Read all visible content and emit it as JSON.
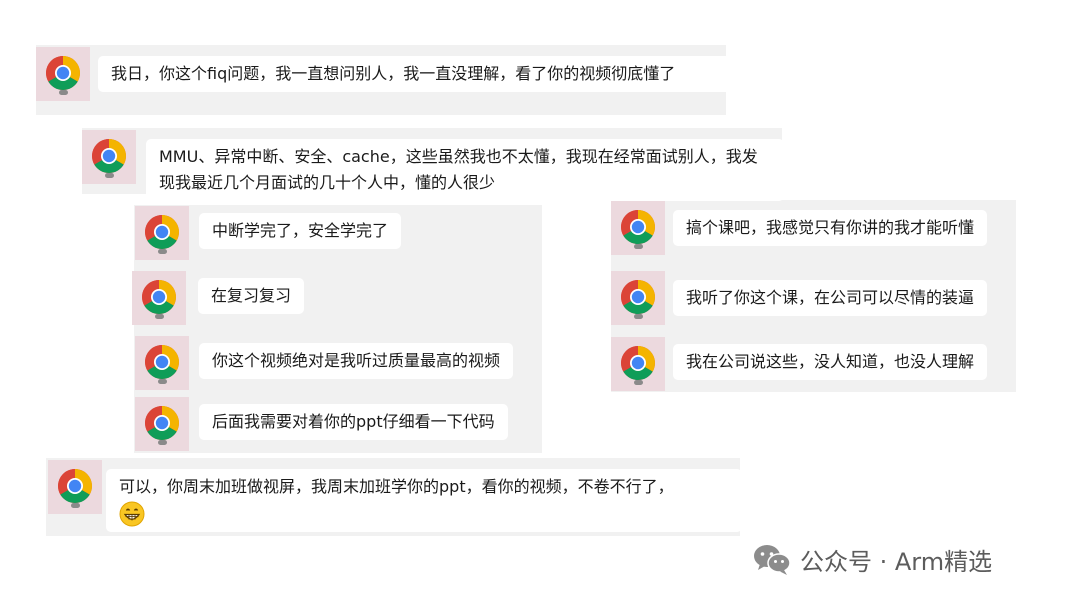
{
  "messages": [
    {
      "text": "我日，你这个fiq问题，我一直想问别人，我一直没理解，看了你的视频彻底懂了",
      "avatar_icon": "chrome-icon"
    },
    {
      "text": "MMU、异常中断、安全、cache，这些虽然我也不太懂，我现在经常面试别人，我发现我最近几个月面试的几十个人中，懂的人很少",
      "avatar_icon": "chrome-icon"
    },
    {
      "text": "中断学完了，安全学完了",
      "avatar_icon": "chrome-icon"
    },
    {
      "text": "在复习复习",
      "avatar_icon": "chrome-icon"
    },
    {
      "text": "你这个视频绝对是我听过质量最高的视频",
      "avatar_icon": "chrome-icon"
    },
    {
      "text": "后面我需要对着你的ppt仔细看一下代码",
      "avatar_icon": "chrome-icon"
    },
    {
      "text": "搞个课吧，我感觉只有你讲的我才能听懂",
      "avatar_icon": "chrome-icon"
    },
    {
      "text": "我听了你这个课，在公司可以尽情的装逼",
      "avatar_icon": "chrome-icon"
    },
    {
      "text": "我在公司说这些，没人知道，也没人理解",
      "avatar_icon": "chrome-icon"
    },
    {
      "text": "可以，你周末加班做视屏，我周末加班学你的ppt，看你的视频，不卷不行了，",
      "avatar_icon": "chrome-icon",
      "emoji": "grinning-face-emoji"
    }
  ],
  "watermark": {
    "text": "公众号 · Arm精选",
    "icon": "wechat-icon"
  },
  "colors": {
    "avatar_bg": "#ecd9de",
    "strip_bg": "#f1f1f1",
    "bubble_bg": "#ffffff"
  }
}
